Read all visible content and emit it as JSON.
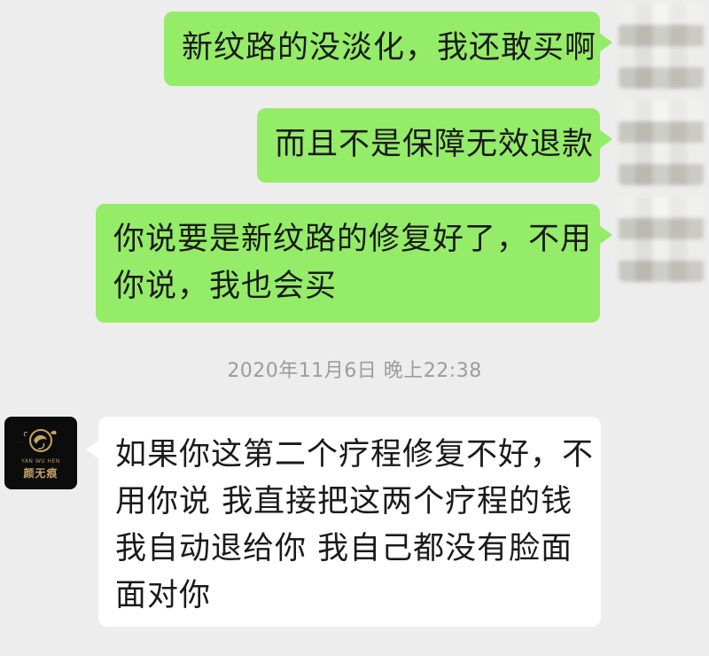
{
  "messages": [
    {
      "side": "out",
      "text": "新纹路的没淡化，我还敢买啊"
    },
    {
      "side": "out",
      "text": "而且不是保障无效退款"
    },
    {
      "side": "out",
      "lines": [
        "你说要是新纹路的修复好了，不用",
        "你说，我也会买"
      ]
    },
    {
      "side": "in",
      "lines": [
        "如果你这第二个疗程修复不好，不",
        "用你说 我直接把这两个疗程的钱",
        "我自动退给你 我自己都没有脸面",
        "面对你"
      ]
    }
  ],
  "timestamp": "2020年11月6日 晚上22:38",
  "contact_avatar": {
    "icon": "brand-logo-icon",
    "brand_small_text": "YAN WU HEN",
    "brand_name": "颜无痕",
    "bg_color": "#0c0c0c",
    "accent_color": "#c6a464"
  },
  "colors": {
    "outgoing_bubble": "#95ec69",
    "incoming_bubble": "#ffffff",
    "background": "#ededed",
    "timestamp_text": "#9c9c9c"
  }
}
